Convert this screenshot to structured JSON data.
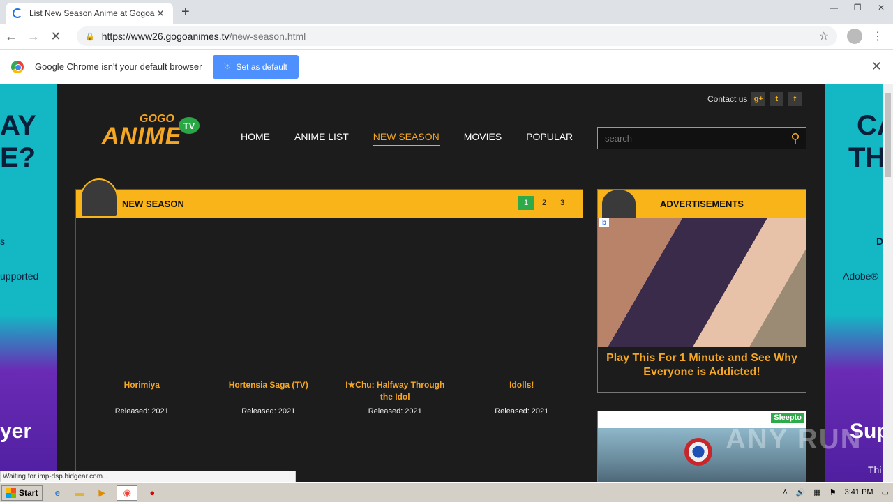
{
  "browser": {
    "tab_title": "List New Season Anime at Gogoanim",
    "tab_close": "✕",
    "new_tab": "+",
    "url_host": "https://www26.gogoanimes.tv",
    "url_path": "/new-season.html",
    "infobar_text": "Google Chrome isn't your default browser",
    "set_default_label": "Set as default",
    "status_text": "Waiting for imp-dsp.bidgear.com..."
  },
  "side_ads": {
    "left_lines": [
      "AY",
      "E?",
      "s",
      "upported",
      "yer"
    ],
    "right_lines": [
      "CA",
      "TH",
      "D",
      "Adobe®",
      "Sup",
      "Thi"
    ]
  },
  "site": {
    "contact_label": "Contact us",
    "social": [
      "g+",
      "t",
      "f"
    ],
    "logo_gogo": "GOGO",
    "logo_anime": "ANIME",
    "logo_tv": "TV",
    "nav": [
      "HOME",
      "ANIME LIST",
      "NEW SEASON",
      "MOVIES",
      "POPULAR"
    ],
    "search_placeholder": "search"
  },
  "new_season": {
    "title": "NEW SEASON",
    "pages": [
      "1",
      "2",
      "3"
    ],
    "items": [
      {
        "name": "Horimiya",
        "released": "Released: 2021"
      },
      {
        "name": "Hortensia Saga (TV)",
        "released": "Released: 2021"
      },
      {
        "name": "I★Chu: Halfway Through the Idol",
        "released": "Released: 2021"
      },
      {
        "name": "Idolls!",
        "released": "Released: 2021"
      }
    ]
  },
  "ads": {
    "title": "ADVERTISEMENTS",
    "ad_text": "Play This For 1 Minute and See Why Everyone is Addicted!",
    "badge": "b",
    "sponsor": "Sleepto"
  },
  "watermark": "ANY RUN",
  "taskbar": {
    "start_label": "Start",
    "clock": "3:41 PM"
  }
}
